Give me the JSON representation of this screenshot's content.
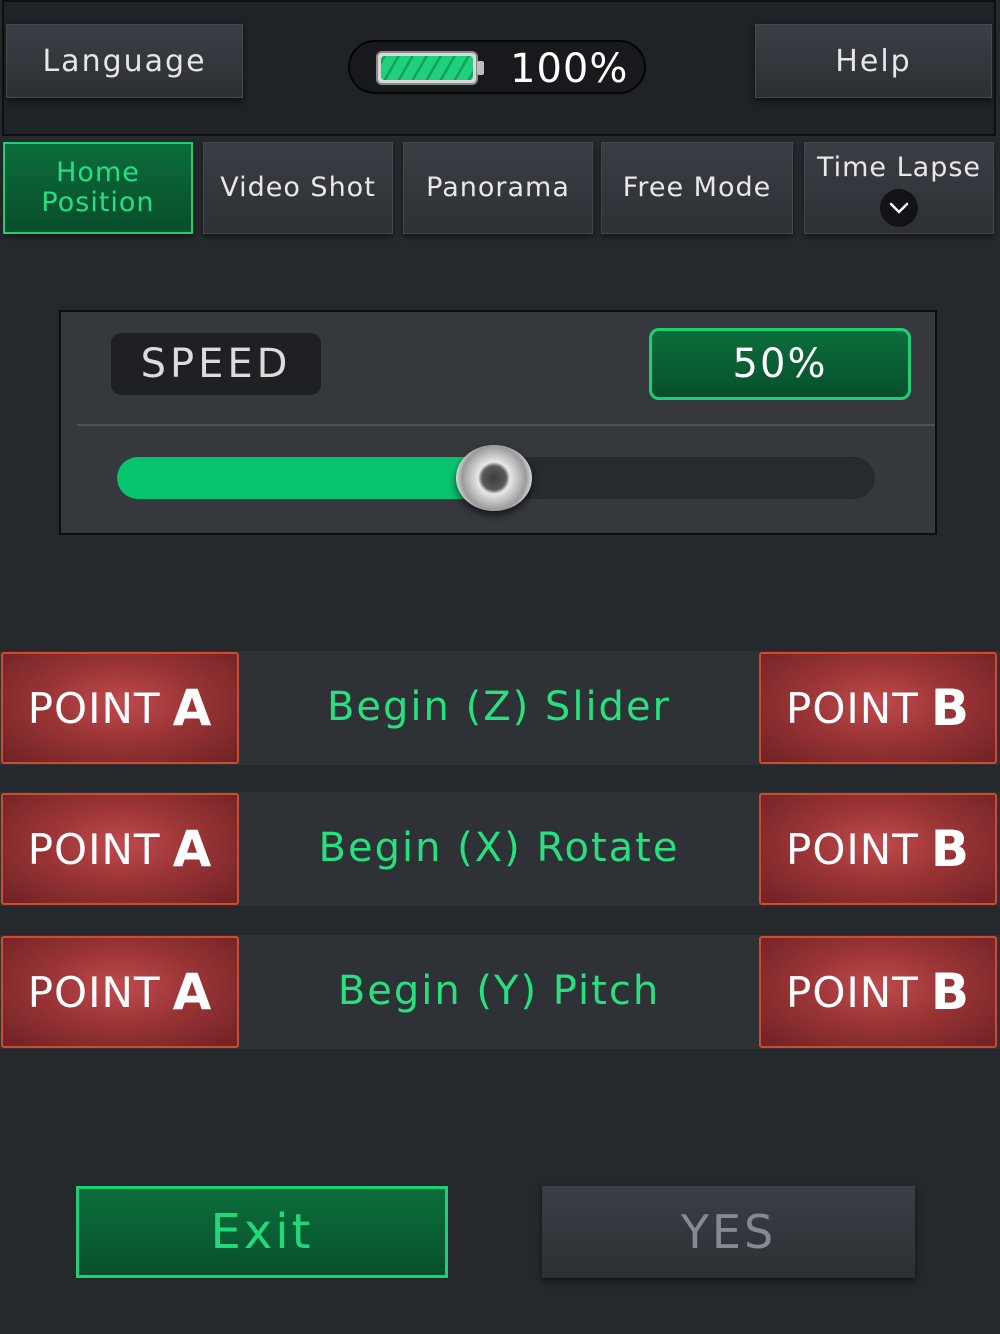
{
  "header": {
    "language_label": "Language",
    "help_label": "Help",
    "battery": {
      "percent_label": "100%",
      "level": 1.0,
      "color": "#1fd17a"
    }
  },
  "tabs": [
    {
      "line1": "Home",
      "line2": "Position",
      "active": true
    },
    {
      "label": "Video Shot",
      "active": false
    },
    {
      "label": "Panorama",
      "active": false
    },
    {
      "label": "Free Mode",
      "active": false
    },
    {
      "label": "Time Lapse",
      "active": false,
      "icon": "chevron-down-icon"
    }
  ],
  "speed": {
    "label": "SPEED",
    "value_label": "50%",
    "value_fraction": 0.5,
    "fill_color": "#09c46f"
  },
  "axes": [
    {
      "left": "POINT",
      "left_letter": "A",
      "label": "Begin (Z) Slider",
      "right": "POINT",
      "right_letter": "B"
    },
    {
      "left": "POINT",
      "left_letter": "A",
      "label": "Begin (X) Rotate",
      "right": "POINT",
      "right_letter": "B"
    },
    {
      "left": "POINT",
      "left_letter": "A",
      "label": "Begin (Y) Pitch",
      "right": "POINT",
      "right_letter": "B"
    }
  ],
  "footer": {
    "exit_label": "Exit",
    "yes_label": "YES"
  },
  "colors": {
    "accent_green": "#1fcf76",
    "point_red": "#9a3436",
    "background": "#25282c"
  }
}
